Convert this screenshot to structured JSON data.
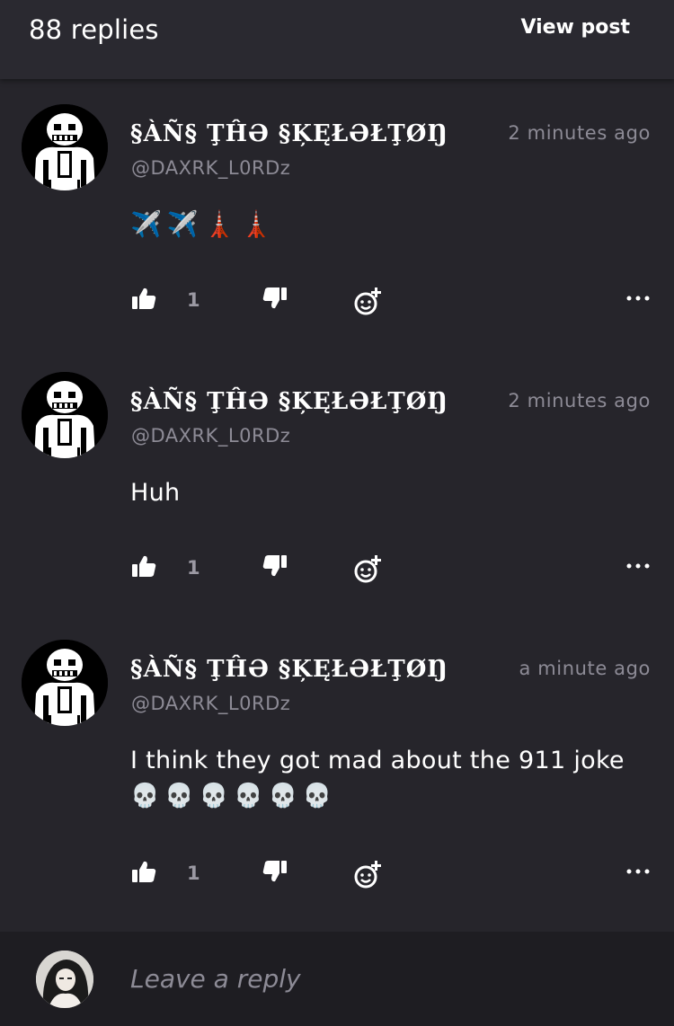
{
  "header": {
    "replies_count": "88 replies",
    "view_post": "View post"
  },
  "replies": [
    {
      "username": "§ÀÑ§ ŢĤƏ §ĶĘŁƏŁŢØŊ",
      "handle": "@DAXRK_L0RDz",
      "time": "2 minutes ago",
      "body": "",
      "emoji": [
        "✈️",
        "✈️",
        "🗼",
        "🗼"
      ],
      "likes": "1"
    },
    {
      "username": "§ÀÑ§ ŢĤƏ §ĶĘŁƏŁŢØŊ",
      "handle": "@DAXRK_L0RDz",
      "time": "2 minutes ago",
      "body": "Huh",
      "emoji": [],
      "likes": "1"
    },
    {
      "username": "§ÀÑ§ ŢĤƏ §ĶĘŁƏŁŢØŊ",
      "handle": "@DAXRK_L0RDz",
      "time": "a minute ago",
      "body": "I think they got mad about the 911 joke",
      "emoji": [
        "💀",
        "💀",
        "💀",
        "💀",
        "💀",
        "💀"
      ],
      "likes": "1"
    }
  ],
  "composer": {
    "placeholder": "Leave a reply"
  },
  "colors": {
    "background": "#26252b",
    "header": "#2a2930",
    "composer": "#1e1d22",
    "muted_text": "#8d8b96"
  },
  "icons": {
    "like": "thumbs-up-icon",
    "dislike": "thumbs-down-icon",
    "react": "add-reaction-icon",
    "more": "more-options-icon"
  }
}
